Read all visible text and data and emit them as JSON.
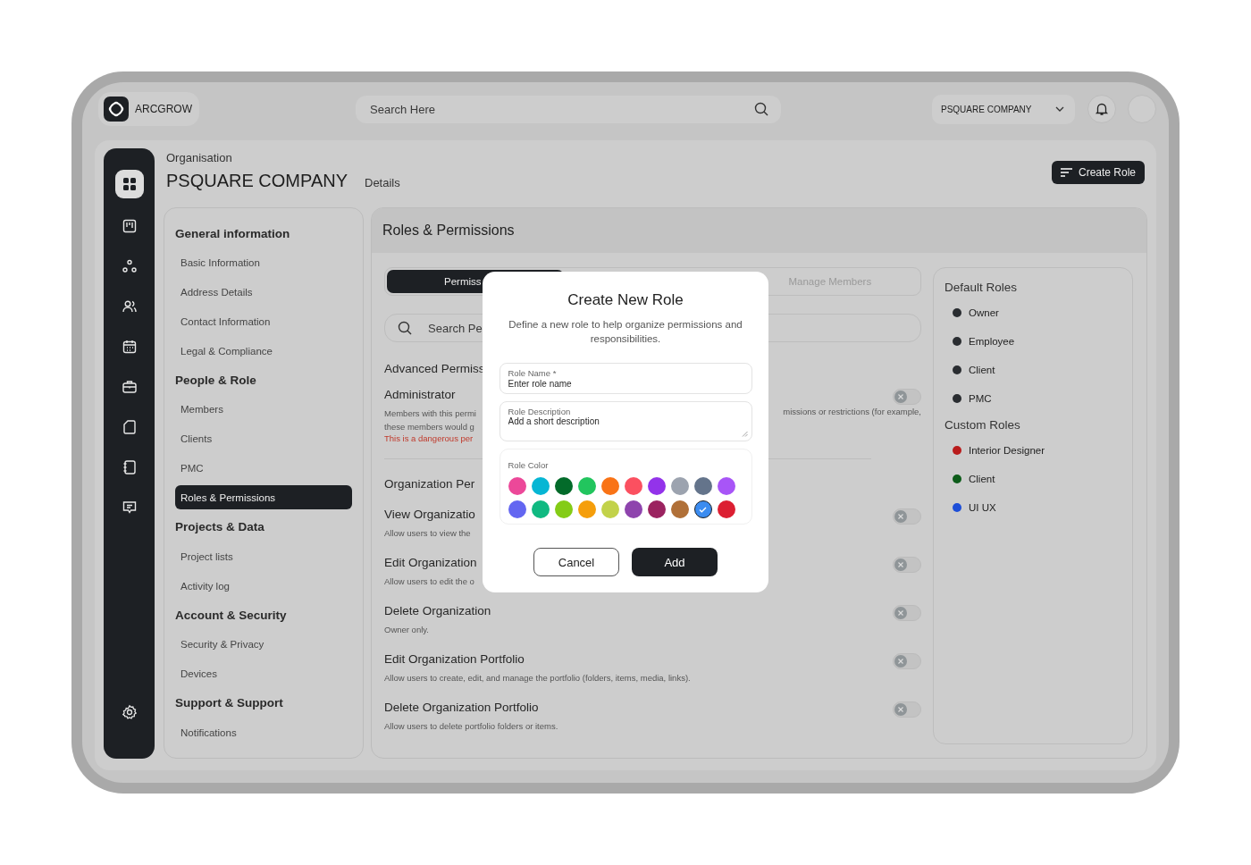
{
  "topbar": {
    "logo_text": "ARCGROW",
    "search_placeholder": "Search Here",
    "company_select": "PSQUARE COMPANY"
  },
  "rail": [
    {
      "selected": true
    },
    {
      "selected": false
    },
    {
      "selected": false
    },
    {
      "selected": false
    },
    {
      "selected": false
    },
    {
      "selected": false
    },
    {
      "selected": false
    },
    {
      "selected": false
    },
    {
      "selected": false
    }
  ],
  "header": {
    "breadcrumb": "Organisation",
    "title": "PSQUARE COMPANY",
    "subtitle": "Details",
    "create_button": "Create Role"
  },
  "nav": [
    {
      "heading": "General information",
      "items": [
        {
          "label": "Basic Information",
          "selected": false
        },
        {
          "label": "Address Details",
          "selected": false
        },
        {
          "label": "Contact Information",
          "selected": false
        },
        {
          "label": "Legal & Compliance",
          "selected": false
        }
      ]
    },
    {
      "heading": "People & Role",
      "items": [
        {
          "label": "Members",
          "selected": false
        },
        {
          "label": "Clients",
          "selected": false
        },
        {
          "label": "PMC",
          "selected": false
        },
        {
          "label": "Roles & Permissions",
          "selected": true
        }
      ]
    },
    {
      "heading": "Projects & Data",
      "items": [
        {
          "label": "Project lists",
          "selected": false
        },
        {
          "label": "Activity log",
          "selected": false
        }
      ]
    },
    {
      "heading": "Account & Security",
      "items": [
        {
          "label": "Security & Privacy",
          "selected": false
        },
        {
          "label": "Devices",
          "selected": false
        }
      ]
    },
    {
      "heading": "Support & Support",
      "items": [
        {
          "label": "Notifications",
          "selected": false
        }
      ]
    }
  ],
  "panel": {
    "title": "Roles & Permissions",
    "tabs": [
      {
        "label": "Permiss",
        "selected": true
      },
      {
        "label": "Manage Members",
        "selected": false
      }
    ],
    "search_placeholder": "Search Pe",
    "advanced": {
      "heading": "Advanced Permiss",
      "title": "Administrator",
      "on": false,
      "line_1": "Members with this permi",
      "line_1_right": "missions or restrictions (for example,",
      "line_2": "these members would g",
      "warning": "This is a dangerous per"
    },
    "organization": {
      "heading": "Organization Per",
      "rows": [
        {
          "title": "View Organizatio",
          "description": "Allow users to view the",
          "on": false
        },
        {
          "title": "Edit Organization",
          "description": "Allow users to edit the o",
          "on": false
        },
        {
          "title": "Delete Organization",
          "description": "Owner only.",
          "on": false
        },
        {
          "title": "Edit Organization Portfolio",
          "description": "Allow users to create, edit, and manage the portfolio (folders, items, media, links).",
          "on": false
        },
        {
          "title": "Delete Organization Portfolio",
          "description": "Allow users to delete portfolio folders or items.",
          "on": false
        }
      ]
    },
    "default_roles": {
      "heading": "Default Roles",
      "items": [
        {
          "label": "Owner",
          "color": "#2a2d31"
        },
        {
          "label": "Employee",
          "color": "#2a2d31"
        },
        {
          "label": "Client",
          "color": "#2a2d31"
        },
        {
          "label": "PMC",
          "color": "#2a2d31"
        }
      ]
    },
    "custom_roles": {
      "heading": "Custom Roles",
      "items": [
        {
          "label": "Interior Designer",
          "color": "#b91c1c"
        },
        {
          "label": "Client",
          "color": "#0d5c1a"
        },
        {
          "label": "UI UX",
          "color": "#1d4ed8"
        }
      ]
    }
  },
  "modal": {
    "title": "Create New Role",
    "description": "Define a new role to help organize permissions and responsibilities.",
    "name_label": "Role Name *",
    "name_placeholder": "Enter role name",
    "description_label": "Role Description",
    "description_placeholder": "Add a short description",
    "color_label": "Role Color",
    "colors": [
      {
        "color": "#ec4899",
        "selected": false
      },
      {
        "color": "#06b6d4",
        "selected": false
      },
      {
        "color": "#036b2a",
        "selected": false
      },
      {
        "color": "#22c55e",
        "selected": false
      },
      {
        "color": "#f97316",
        "selected": false
      },
      {
        "color": "#fb5060",
        "selected": false
      },
      {
        "color": "#9333ea",
        "selected": false
      },
      {
        "color": "#9ca3af",
        "selected": false
      },
      {
        "color": "#64748b",
        "selected": false
      },
      {
        "color": "#a855f7",
        "selected": false
      },
      {
        "color": "#6366f1",
        "selected": false
      },
      {
        "color": "#10b981",
        "selected": false
      },
      {
        "color": "#84cc16",
        "selected": false
      },
      {
        "color": "#f59e0b",
        "selected": false
      },
      {
        "color": "#c2d24a",
        "selected": false
      },
      {
        "color": "#8e44ad",
        "selected": false
      },
      {
        "color": "#9b2360",
        "selected": false
      },
      {
        "color": "#b07038",
        "selected": false
      },
      {
        "color": "#3b8cf0",
        "selected": true
      },
      {
        "color": "#dc1f32",
        "selected": false
      }
    ],
    "cancel_button": "Cancel",
    "add_button": "Add"
  }
}
